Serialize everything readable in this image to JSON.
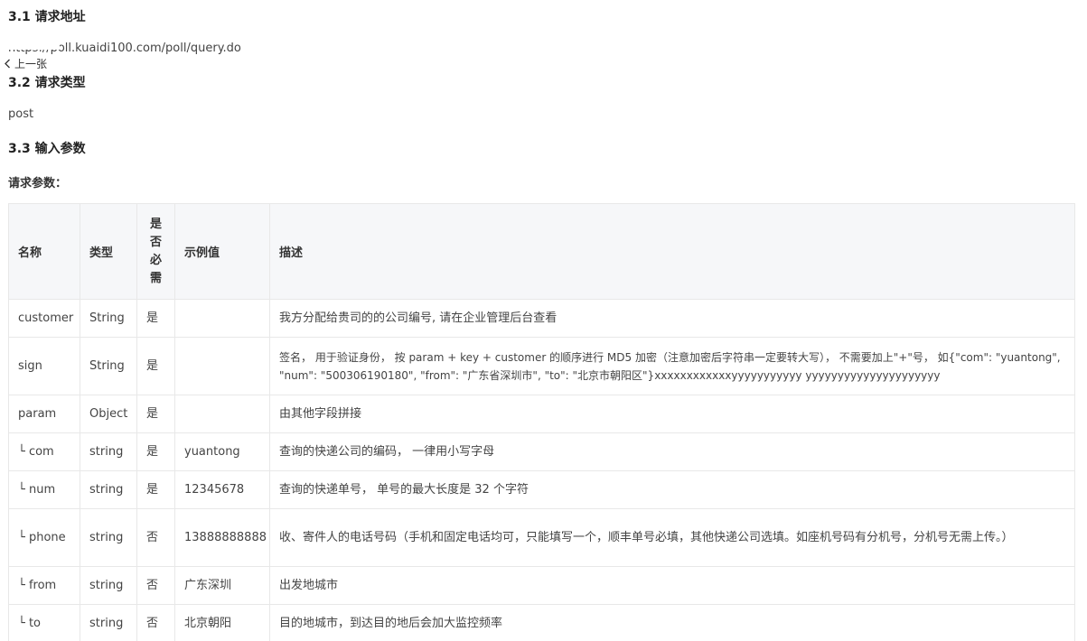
{
  "sections": [
    {
      "heading": "3.1 请求地址",
      "content": "https://poll.kuaidi100.com/poll/query.do"
    },
    {
      "heading": "3.2 请求类型",
      "content": "post"
    },
    {
      "heading": "3.3 输入参数",
      "content": "请求参数："
    }
  ],
  "prev_link": "上一张",
  "table": {
    "headers": [
      "名称",
      "类型",
      "是否必需",
      "示例值",
      "描述"
    ],
    "required_header_chars": [
      "是",
      "否",
      "必",
      "需"
    ],
    "rows": [
      {
        "name": "customer",
        "type": "String",
        "required": "是",
        "example": "",
        "desc": "我方分配给贵司的的公司编号, 请在企业管理后台查看"
      },
      {
        "name": "sign",
        "type": "String",
        "required": "是",
        "example": "",
        "desc": "签名， 用于验证身份， 按 param + key + customer 的顺序进行 MD5 加密（注意加密后字符串一定要转大写）， 不需要加上\"+\"号， 如{\"com\": \"yuantong\", \"num\": \"500306190180\", \"from\": \"广东省深圳市\", \"to\": \"北京市朝阳区\"}xxxxxxxxxxxxyyyyyyyyyyy yyyyyyyyyyyyyyyyyyyyy"
      },
      {
        "name": "param",
        "type": "Object",
        "required": "是",
        "example": "",
        "desc": "由其他字段拼接"
      },
      {
        "name": "└ com",
        "type": "string",
        "required": "是",
        "example": "yuantong",
        "desc": "查询的快递公司的编码， 一律用小写字母"
      },
      {
        "name": "└ num",
        "type": "string",
        "required": "是",
        "example": "12345678",
        "desc": "查询的快递单号， 单号的最大长度是 32 个字符"
      },
      {
        "name": "└ phone",
        "type": "string",
        "required": "否",
        "example": "13888888888",
        "desc": "收、寄件人的电话号码（手机和固定电话均可，只能填写一个，顺丰单号必填，其他快递公司选填。如座机号码有分机号，分机号无需上传。）"
      },
      {
        "name": "└ from",
        "type": "string",
        "required": "否",
        "example": "广东深圳",
        "desc": "出发地城市"
      },
      {
        "name": "└ to",
        "type": "string",
        "required": "否",
        "example": "北京朝阳",
        "desc": "目的地城市，到达目的地后会加大监控频率"
      }
    ]
  }
}
